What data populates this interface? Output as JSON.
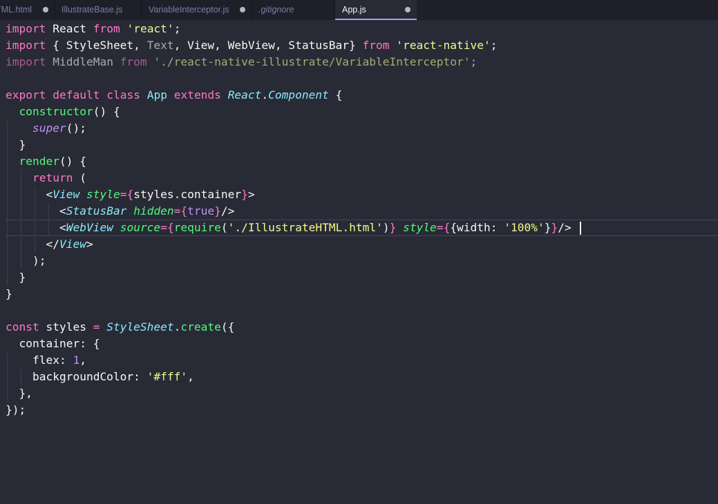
{
  "tabs": [
    {
      "label": "TML.html",
      "active": false
    },
    {
      "label": "IllustrateBase.js",
      "active": false
    },
    {
      "label": "VariableInterceptor.js",
      "active": false
    },
    {
      "label": ".gitignore",
      "active": false
    },
    {
      "label": "App.js",
      "active": true
    }
  ],
  "colors": {
    "background": "#282a36",
    "keyword": "#ff79c6",
    "string": "#f1fa8c",
    "function": "#50fa7b",
    "class": "#8be9fd",
    "number": "#bd93f9",
    "text": "#f8f8f2"
  },
  "code": {
    "l1": [
      {
        "t": "import",
        "c": "kw"
      },
      {
        "t": " React ",
        "c": ""
      },
      {
        "t": "from",
        "c": "kw"
      },
      {
        "t": " ",
        "c": ""
      },
      {
        "t": "'react'",
        "c": "str"
      },
      {
        "t": ";",
        "c": ""
      }
    ],
    "l2": [
      {
        "t": "import",
        "c": "kw"
      },
      {
        "t": " { StyleSheet, ",
        "c": ""
      },
      {
        "t": "Text",
        "c": "dim"
      },
      {
        "t": ", View, WebView, StatusBar} ",
        "c": ""
      },
      {
        "t": "from",
        "c": "kw"
      },
      {
        "t": " ",
        "c": ""
      },
      {
        "t": "'react-native'",
        "c": "str"
      },
      {
        "t": ";",
        "c": ""
      }
    ],
    "l3": [
      {
        "t": "import",
        "c": "kw dim"
      },
      {
        "t": " MiddleMan ",
        "c": "dim"
      },
      {
        "t": "from",
        "c": "kw dim"
      },
      {
        "t": " ",
        "c": "dim"
      },
      {
        "t": "'./react-native-illustrate/VariableInterceptor'",
        "c": "str dim"
      },
      {
        "t": ";",
        "c": "dim"
      }
    ],
    "l5": [
      {
        "t": "export",
        "c": "kw"
      },
      {
        "t": " ",
        "c": ""
      },
      {
        "t": "default",
        "c": "kw"
      },
      {
        "t": " ",
        "c": ""
      },
      {
        "t": "class",
        "c": "kw"
      },
      {
        "t": " ",
        "c": ""
      },
      {
        "t": "App",
        "c": "cls"
      },
      {
        "t": " ",
        "c": ""
      },
      {
        "t": "extends",
        "c": "kw"
      },
      {
        "t": " ",
        "c": ""
      },
      {
        "t": "React",
        "c": "it"
      },
      {
        "t": ".",
        "c": ""
      },
      {
        "t": "Component",
        "c": "it"
      },
      {
        "t": " {",
        "c": ""
      }
    ],
    "l6": [
      {
        "t": "  ",
        "c": ""
      },
      {
        "t": "constructor",
        "c": "fn"
      },
      {
        "t": "() {",
        "c": ""
      }
    ],
    "l7": [
      {
        "t": "    ",
        "c": ""
      },
      {
        "t": "super",
        "c": "sup"
      },
      {
        "t": "();",
        "c": ""
      }
    ],
    "l8": [
      {
        "t": "  }",
        "c": ""
      }
    ],
    "l9": [
      {
        "t": "  ",
        "c": ""
      },
      {
        "t": "render",
        "c": "fn"
      },
      {
        "t": "() {",
        "c": ""
      }
    ],
    "l10": [
      {
        "t": "    ",
        "c": ""
      },
      {
        "t": "return",
        "c": "kw"
      },
      {
        "t": " (",
        "c": ""
      }
    ],
    "l11": [
      {
        "t": "      <",
        "c": ""
      },
      {
        "t": "View",
        "c": "it"
      },
      {
        "t": " ",
        "c": ""
      },
      {
        "t": "style",
        "c": "attr"
      },
      {
        "t": "=",
        "c": "kw"
      },
      {
        "t": "{",
        "c": "br"
      },
      {
        "t": "styles.container",
        "c": ""
      },
      {
        "t": "}",
        "c": "br"
      },
      {
        "t": ">",
        "c": ""
      }
    ],
    "l12": [
      {
        "t": "        <",
        "c": ""
      },
      {
        "t": "StatusBar",
        "c": "it"
      },
      {
        "t": " ",
        "c": ""
      },
      {
        "t": "hidden",
        "c": "attr"
      },
      {
        "t": "=",
        "c": "kw"
      },
      {
        "t": "{",
        "c": "br"
      },
      {
        "t": "true",
        "c": "num"
      },
      {
        "t": "}",
        "c": "br"
      },
      {
        "t": "/>",
        "c": ""
      }
    ],
    "l13": [
      {
        "t": "        <",
        "c": ""
      },
      {
        "t": "WebView",
        "c": "it"
      },
      {
        "t": " ",
        "c": ""
      },
      {
        "t": "source",
        "c": "attr"
      },
      {
        "t": "=",
        "c": "kw"
      },
      {
        "t": "{",
        "c": "br"
      },
      {
        "t": "require",
        "c": "fn"
      },
      {
        "t": "(",
        "c": ""
      },
      {
        "t": "'./IllustrateHTML.html'",
        "c": "str"
      },
      {
        "t": ")",
        "c": ""
      },
      {
        "t": "}",
        "c": "br"
      },
      {
        "t": " ",
        "c": ""
      },
      {
        "t": "style",
        "c": "attr"
      },
      {
        "t": "=",
        "c": "kw"
      },
      {
        "t": "{",
        "c": "br"
      },
      {
        "t": "{width: ",
        "c": ""
      },
      {
        "t": "'100%'",
        "c": "str"
      },
      {
        "t": "}",
        "c": ""
      },
      {
        "t": "}",
        "c": "br"
      },
      {
        "t": "/>",
        "c": ""
      }
    ],
    "l14": [
      {
        "t": "      </",
        "c": ""
      },
      {
        "t": "View",
        "c": "it"
      },
      {
        "t": ">",
        "c": ""
      }
    ],
    "l15": [
      {
        "t": "    );",
        "c": ""
      }
    ],
    "l16": [
      {
        "t": "  }",
        "c": ""
      }
    ],
    "l17": [
      {
        "t": "}",
        "c": ""
      }
    ],
    "l19": [
      {
        "t": "const",
        "c": "kw"
      },
      {
        "t": " styles ",
        "c": ""
      },
      {
        "t": "=",
        "c": "kw"
      },
      {
        "t": " ",
        "c": ""
      },
      {
        "t": "StyleSheet",
        "c": "it"
      },
      {
        "t": ".",
        "c": ""
      },
      {
        "t": "create",
        "c": "fn"
      },
      {
        "t": "({",
        "c": ""
      }
    ],
    "l20": [
      {
        "t": "  container: {",
        "c": ""
      }
    ],
    "l21": [
      {
        "t": "    flex: ",
        "c": ""
      },
      {
        "t": "1",
        "c": "num"
      },
      {
        "t": ",",
        "c": ""
      }
    ],
    "l22": [
      {
        "t": "    backgroundColor: ",
        "c": ""
      },
      {
        "t": "'#fff'",
        "c": "str"
      },
      {
        "t": ",",
        "c": ""
      }
    ],
    "l23": [
      {
        "t": "  },",
        "c": ""
      }
    ],
    "l24": [
      {
        "t": "});",
        "c": ""
      }
    ]
  }
}
